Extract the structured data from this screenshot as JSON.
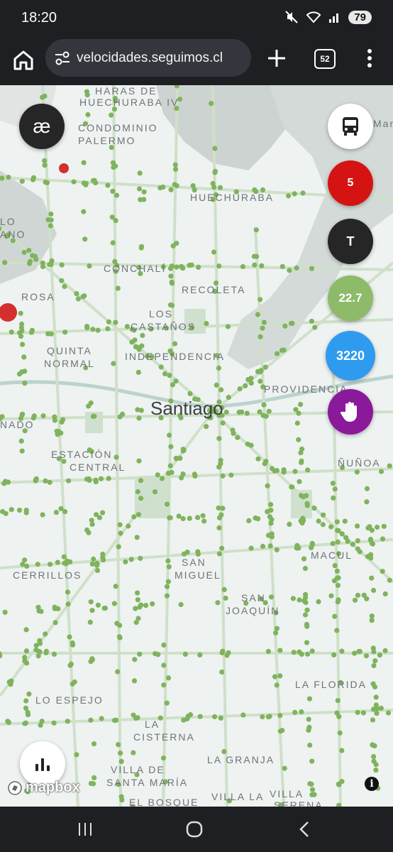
{
  "status_bar": {
    "time": "18:20",
    "battery": "79",
    "icons": [
      "mute-icon",
      "wifi-icon",
      "signal-icon"
    ]
  },
  "browser": {
    "url": "velocidades.seguimos.cl",
    "tab_count": "52"
  },
  "map": {
    "places": [
      {
        "name": "place-huechuraba-iv",
        "text": "HARAS DE"
      },
      {
        "name": "place-huechuraba-iv-2",
        "text": "HUECHURABA IV"
      },
      {
        "name": "place-condominio",
        "text": "CONDOMINIO"
      },
      {
        "name": "place-palermo",
        "text": "PALERMO"
      },
      {
        "name": "place-huechuraba",
        "text": "HUECHURABA"
      },
      {
        "name": "place-conchali",
        "text": "CONCHALÍ"
      },
      {
        "name": "place-recoleta",
        "text": "RECOLETA"
      },
      {
        "name": "place-los-castanos-1",
        "text": "LOS"
      },
      {
        "name": "place-los-castanos-2",
        "text": "CASTAÑOS"
      },
      {
        "name": "place-quinta-normal-1",
        "text": "QUINTA"
      },
      {
        "name": "place-quinta-normal-2",
        "text": "NORMAL"
      },
      {
        "name": "place-independencia",
        "text": "INDEPENDENCIA"
      },
      {
        "name": "place-providencia",
        "text": "PROVIDENCIA"
      },
      {
        "name": "place-estacion-central-1",
        "text": "ESTACIÓN"
      },
      {
        "name": "place-estacion-central-2",
        "text": "CENTRAL"
      },
      {
        "name": "place-nunoa",
        "text": "ÑUÑOA"
      },
      {
        "name": "place-macul",
        "text": "MACUL"
      },
      {
        "name": "place-cerrillos",
        "text": "CERRILLOS"
      },
      {
        "name": "place-san-miguel-1",
        "text": "SAN"
      },
      {
        "name": "place-san-miguel-2",
        "text": "MIGUEL"
      },
      {
        "name": "place-san-joaquin-1",
        "text": "SAN"
      },
      {
        "name": "place-san-joaquin-2",
        "text": "JOAQUÍN"
      },
      {
        "name": "place-la-florida",
        "text": "LA FLORIDA"
      },
      {
        "name": "place-lo-espejo",
        "text": "LO ESPEJO"
      },
      {
        "name": "place-la-cisterna-1",
        "text": "LA"
      },
      {
        "name": "place-la-cisterna-2",
        "text": "CISTERNA"
      },
      {
        "name": "place-la-granja",
        "text": "LA GRANJA"
      },
      {
        "name": "place-villa-santa-maria-1",
        "text": "VILLA DE"
      },
      {
        "name": "place-villa-santa-maria-2",
        "text": "SANTA MARÍA"
      },
      {
        "name": "place-el-bosque",
        "text": "EL BOSQUE"
      },
      {
        "name": "place-villa-la",
        "text": "VILLA LA"
      },
      {
        "name": "place-villa-serena",
        "text": "VILLA"
      },
      {
        "name": "place-villa-serena-2",
        "text": "SERENA"
      },
      {
        "name": "place-lo",
        "text": "LO"
      },
      {
        "name": "place-lo-2",
        "text": "ANO"
      },
      {
        "name": "place-rosa",
        "text": "ROSA"
      },
      {
        "name": "place-nado",
        "text": "NADO"
      },
      {
        "name": "place-mani",
        "text": "Mani"
      }
    ],
    "city_label": "Santiago",
    "attribution": "mapbox"
  },
  "controls": {
    "ae_label": "æ",
    "line_label": "5",
    "mode_label": "T",
    "speed_label": "22.7",
    "count_label": "3220",
    "colors": {
      "ae": "#262626",
      "line": "#d61313",
      "mode": "#262626",
      "speed": "#8dbb69",
      "count": "#2f9bef",
      "stop": "#8b1a9b",
      "dot": "#7fb35d",
      "slow_dot": "#d32f2f"
    }
  }
}
